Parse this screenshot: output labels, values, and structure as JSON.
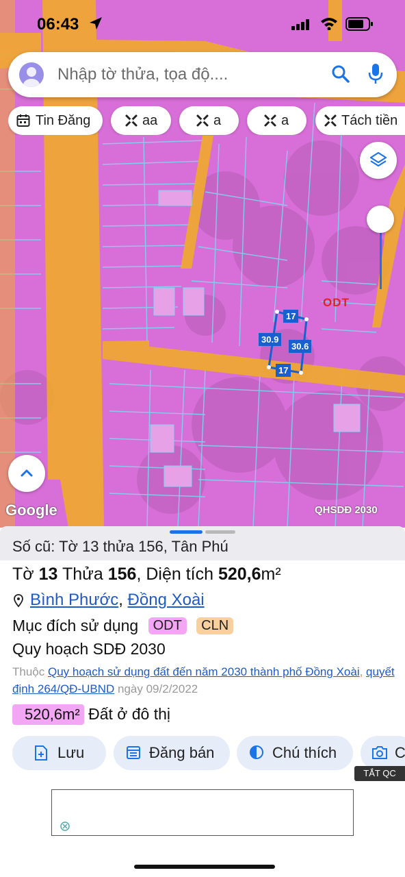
{
  "status": {
    "time": "06:43"
  },
  "search": {
    "placeholder": "Nhập tờ thửa, tọa độ...."
  },
  "chips": [
    {
      "label": "Tin Đăng",
      "icon": "calendar-icon"
    },
    {
      "label": "aa",
      "icon": "cross-tools-icon"
    },
    {
      "label": "a",
      "icon": "cross-tools-icon"
    },
    {
      "label": "a",
      "icon": "cross-tools-icon"
    },
    {
      "label": "Tách tiền",
      "icon": "cross-tools-icon"
    }
  ],
  "map": {
    "zone_label": "ODT",
    "dims": {
      "top": "17",
      "left": "30.9",
      "right": "30.6",
      "bottom": "17"
    },
    "logo": "Google",
    "layer_tag": "QHSDĐ 2030",
    "colors": {
      "zone": "#d86fd8",
      "road": "#f0a830",
      "parcel_line": "#7fd6f0",
      "selected": "#1a5fd0"
    }
  },
  "sheet": {
    "old_ref": "Số cũ: Tờ 13 thửa 156, Tân Phú",
    "title": {
      "to_word": "Tờ",
      "to_num": "13",
      "thua_word": "Thửa",
      "thua_num": "156",
      "area_label": "Diện tích",
      "area_value": "520,6",
      "area_unit": "m²"
    },
    "province": "Bình Phước",
    "district": "Đồng Xoài",
    "purpose_label": "Mục đích sử dụng",
    "tags": [
      "ODT",
      "CLN"
    ],
    "plan_title": "Quy hoạch SDĐ 2030",
    "plan_desc": {
      "prefix": "Thuộc",
      "link1": "Quy hoạch sử dụng đất đến năm 2030 thành phố Đồng Xoài",
      "link2": "quyết định 264/QĐ-UBND",
      "date_text": "ngày 09/2/2022"
    },
    "area_badge": "520,6m²",
    "area_type": "Đất ở đô thị",
    "actions": [
      {
        "label": "Lưu",
        "icon": "file-plus-icon"
      },
      {
        "label": "Đăng bán",
        "icon": "calendar-icon"
      },
      {
        "label": "Chú thích",
        "icon": "contrast-icon"
      },
      {
        "label": "C",
        "icon": "camera-icon"
      }
    ],
    "hide_ads": "TẮT QC"
  }
}
